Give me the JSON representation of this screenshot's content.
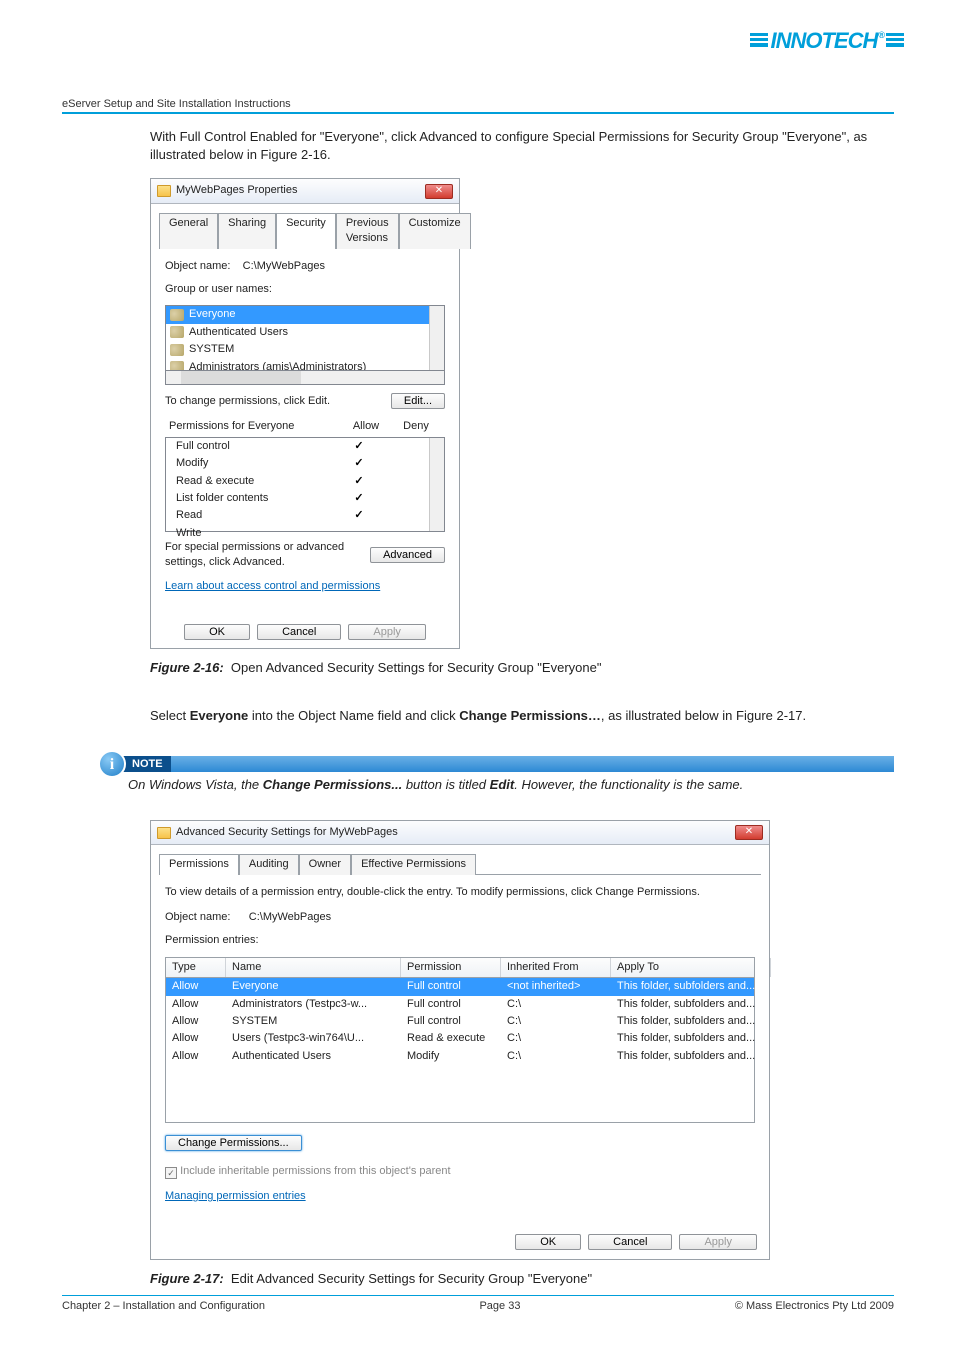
{
  "header": {
    "logo_text": "INNOTECH",
    "doc_title": "eServer Setup and Site Installation Instructions"
  },
  "intro": {
    "text": "With Full Control Enabled for \"Everyone\", click Advanced to configure Special Permissions for Security Group \"Everyone\", as illustrated below in Figure 2-16."
  },
  "dialog1": {
    "title": "MyWebPages Properties",
    "close": "✕",
    "tabs": {
      "general": "General",
      "sharing": "Sharing",
      "security": "Security",
      "previous": "Previous Versions",
      "customize": "Customize"
    },
    "object_label": "Object name:",
    "object_value": "C:\\MyWebPages",
    "group_label": "Group or user names:",
    "group_items": {
      "everyone": "Everyone",
      "auth": "Authenticated Users",
      "system": "SYSTEM",
      "admins": "Administrators (amis\\Administrators)"
    },
    "change_text": "To change permissions, click Edit.",
    "edit_btn": "Edit...",
    "perm_title": "Permissions for Everyone",
    "allow_h": "Allow",
    "deny_h": "Deny",
    "perms": {
      "full": "Full control",
      "modify": "Modify",
      "rx": "Read & execute",
      "list": "List folder contents",
      "read": "Read",
      "write": "Write"
    },
    "special_text": "For special permissions or advanced settings, click Advanced.",
    "adv_btn": "Advanced",
    "learn": "Learn about access control and permissions",
    "ok": "OK",
    "cancel": "Cancel",
    "apply": "Apply"
  },
  "fig216": {
    "label": "Figure 2-16:",
    "caption": "Open Advanced Security Settings for Security Group \"Everyone\""
  },
  "mid": {
    "pre": "Select ",
    "ev": "Everyone",
    "mid1": " into the Object Name field and click ",
    "cp": "Change Permissions…",
    "post": ", as illustrated below in Figure 2-17."
  },
  "note": {
    "label": "NOTE",
    "i": "i",
    "pre": "On Windows Vista, the ",
    "cp": "Change Permissions...",
    "mid": " button is titled ",
    "edit": "Edit",
    "post": ".  However, the functionality is the same."
  },
  "dialog2": {
    "title": "Advanced Security Settings for MyWebPages",
    "close": "✕",
    "tabs": {
      "perm": "Permissions",
      "audit": "Auditing",
      "owner": "Owner",
      "eff": "Effective Permissions"
    },
    "instr": "To view details of a permission entry, double-click the entry. To modify permissions, click Change Permissions.",
    "object_label": "Object name:",
    "object_value": "C:\\MyWebPages",
    "pe_label": "Permission entries:",
    "cols": {
      "type": "Type",
      "name": "Name",
      "perm": "Permission",
      "inh": "Inherited From",
      "apply": "Apply To"
    },
    "rows": [
      {
        "type": "Allow",
        "name": "Everyone",
        "perm": "Full control",
        "inh": "<not inherited>",
        "apply": "This folder, subfolders and..."
      },
      {
        "type": "Allow",
        "name": "Administrators (Testpc3-w...",
        "perm": "Full control",
        "inh": "C:\\",
        "apply": "This folder, subfolders and..."
      },
      {
        "type": "Allow",
        "name": "SYSTEM",
        "perm": "Full control",
        "inh": "C:\\",
        "apply": "This folder, subfolders and..."
      },
      {
        "type": "Allow",
        "name": "Users (Testpc3-win764\\U...",
        "perm": "Read & execute",
        "inh": "C:\\",
        "apply": "This folder, subfolders and..."
      },
      {
        "type": "Allow",
        "name": "Authenticated Users",
        "perm": "Modify",
        "inh": "C:\\",
        "apply": "This folder, subfolders and..."
      }
    ],
    "chg_btn": "Change Permissions...",
    "cb_label": "Include inheritable permissions from this object's parent",
    "cb_check": "✓",
    "manage": "Managing permission entries",
    "ok": "OK",
    "cancel": "Cancel",
    "apply": "Apply"
  },
  "fig217": {
    "label": "Figure 2-17:",
    "caption": "Edit Advanced Security Settings for Security Group \"Everyone\""
  },
  "footer": {
    "left": "Chapter 2 – Installation and Configuration",
    "center": "Page 33",
    "right": "© Mass Electronics Pty Ltd  2009"
  }
}
